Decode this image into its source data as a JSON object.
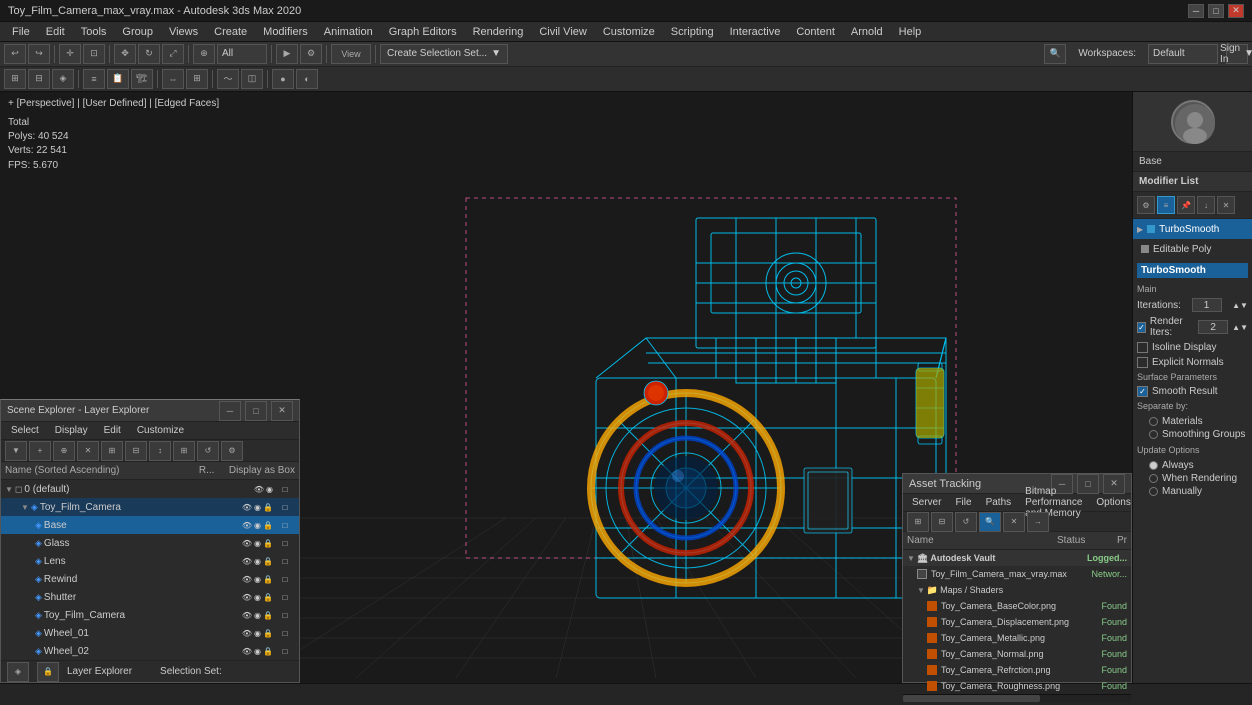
{
  "titleBar": {
    "title": "Toy_Film_Camera_max_vray.max - Autodesk 3ds Max 2020",
    "controls": [
      "minimize",
      "maximize",
      "close"
    ]
  },
  "menuBar": {
    "items": [
      "File",
      "Edit",
      "Tools",
      "Group",
      "Views",
      "Create",
      "Modifiers",
      "Animation",
      "Graph Editors",
      "Rendering",
      "Civil View",
      "Customize",
      "Scripting",
      "Interactive",
      "Content",
      "Arnold",
      "Help"
    ]
  },
  "toolbar": {
    "dropdown1": "All",
    "viewLabel": "View",
    "selectionSet": "Create Selection Set...",
    "workspaces": "Workspaces:",
    "workspaceValue": "Default",
    "signIn": "Sign In"
  },
  "viewport": {
    "label": "+ [Perspective] | [User Defined] | [Edged Faces]",
    "stats": {
      "totalLabel": "Total",
      "polysLabel": "Polys:",
      "polysValue": "40 524",
      "vertsLabel": "Verts:",
      "vertsValue": "22 541"
    },
    "fps": {
      "label": "FPS:",
      "value": "5.670"
    }
  },
  "rightPanel": {
    "baseLabel": "Base",
    "modifierListLabel": "Modifier List",
    "modifiers": [
      {
        "name": "TurboSmooth",
        "active": true
      },
      {
        "name": "Editable Poly",
        "active": false
      }
    ],
    "turboSmooth": {
      "header": "TurboSmooth",
      "mainLabel": "Main",
      "iterationsLabel": "Iterations:",
      "iterationsValue": "1",
      "renderIterationsLabel": "Render Iters:",
      "renderIterationsValue": "2",
      "isolineDisplay": "Isoline Display",
      "explicitNormals": "Explicit Normals",
      "surfaceParamsLabel": "Surface Parameters",
      "smoothResult": "Smooth Result",
      "separateByLabel": "Separate by:",
      "materials": "Materials",
      "smoothingGroups": "Smoothing Groups",
      "updateOptionsLabel": "Update Options",
      "always": "Always",
      "whenRendering": "When Rendering",
      "manually": "Manually"
    }
  },
  "sceneExplorer": {
    "title": "Scene Explorer - Layer Explorer",
    "menus": [
      "Select",
      "Display",
      "Edit",
      "Customize"
    ],
    "colHeaders": {
      "name": "Name (Sorted Ascending)",
      "r": "R...",
      "display": "Display as Box"
    },
    "items": [
      {
        "name": "0 (default)",
        "level": 0,
        "type": "layer"
      },
      {
        "name": "Toy_Film_Camera",
        "level": 1,
        "type": "group",
        "expanded": true
      },
      {
        "name": "Base",
        "level": 2,
        "type": "mesh",
        "selected": true
      },
      {
        "name": "Glass",
        "level": 2,
        "type": "mesh"
      },
      {
        "name": "Lens",
        "level": 2,
        "type": "mesh"
      },
      {
        "name": "Rewind",
        "level": 2,
        "type": "mesh"
      },
      {
        "name": "Shutter",
        "level": 2,
        "type": "mesh"
      },
      {
        "name": "Toy_Film_Camera",
        "level": 2,
        "type": "mesh"
      },
      {
        "name": "Wheel_01",
        "level": 2,
        "type": "mesh"
      },
      {
        "name": "Wheel_02",
        "level": 2,
        "type": "mesh"
      }
    ],
    "footer": {
      "layerExplorer": "Layer Explorer",
      "selectionSet": "Selection Set:"
    }
  },
  "assetTracking": {
    "title": "Asset Tracking",
    "menus": [
      "Server",
      "File",
      "Paths",
      "Bitmap Performance and Memory",
      "Options"
    ],
    "colHeaders": {
      "name": "Name",
      "status": "Status",
      "pr": "Pr"
    },
    "items": [
      {
        "name": "Autodesk Vault",
        "level": 0,
        "type": "vault",
        "status": "Logged..."
      },
      {
        "name": "Toy_Film_Camera_max_vray.max",
        "level": 1,
        "type": "file",
        "status": "Networ..."
      },
      {
        "name": "Maps / Shaders",
        "level": 1,
        "type": "folder"
      },
      {
        "name": "Toy_Camera_BaseColor.png",
        "level": 2,
        "type": "texture",
        "status": "Found"
      },
      {
        "name": "Toy_Camera_Displacement.png",
        "level": 2,
        "type": "texture",
        "status": "Found"
      },
      {
        "name": "Toy_Camera_Metallic.png",
        "level": 2,
        "type": "texture",
        "status": "Found"
      },
      {
        "name": "Toy_Camera_Normal.png",
        "level": 2,
        "type": "texture",
        "status": "Found"
      },
      {
        "name": "Toy_Camera_Refrction.png",
        "level": 2,
        "type": "texture",
        "status": "Found"
      },
      {
        "name": "Toy_Camera_Roughness.png",
        "level": 2,
        "type": "texture",
        "status": "Found"
      }
    ]
  },
  "statusBar": {
    "text": ""
  },
  "icons": {
    "expand": "▶",
    "collapse": "▼",
    "check": "✓",
    "eye": "👁",
    "lock": "🔒",
    "lightbulb": "💡",
    "close": "✕",
    "minimize": "─",
    "maximize": "□",
    "folder": "📁",
    "mesh": "◈",
    "layer": "◻"
  }
}
